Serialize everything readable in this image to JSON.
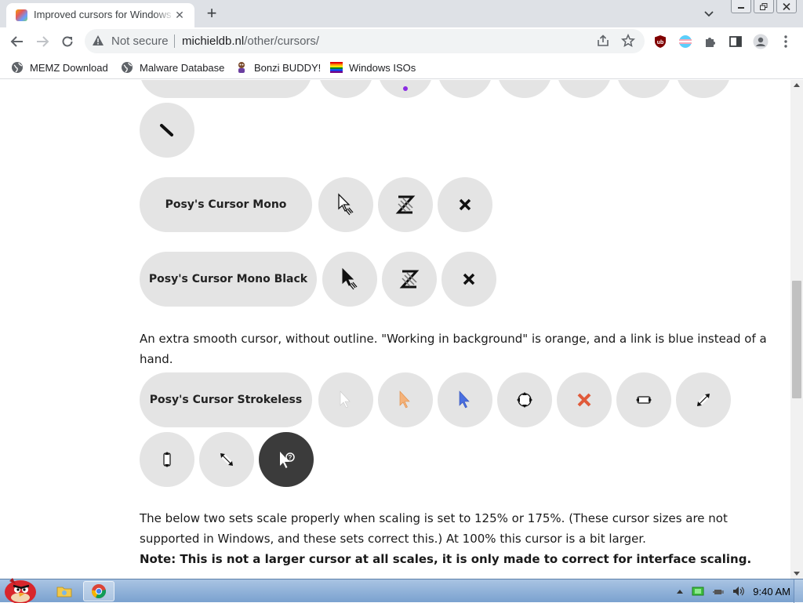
{
  "browser": {
    "tab_title": "Improved cursors for Windows",
    "omnibox": {
      "security_label": "Not secure",
      "domain": "michieldb.nl",
      "path": "/other/cursors/"
    },
    "bookmarks": [
      {
        "label": "MEMZ Download",
        "icon": "globe-icon"
      },
      {
        "label": "Malware Database",
        "icon": "globe-icon"
      },
      {
        "label": "Bonzi BUDDY!",
        "icon": "bonzi-icon"
      },
      {
        "label": "Windows ISOs",
        "icon": "rainbow-flag-icon"
      }
    ]
  },
  "page": {
    "sets": [
      {
        "name": "Posy's Cursor Mono"
      },
      {
        "name": "Posy's Cursor Mono Black"
      },
      {
        "name": "Posy's Cursor Strokeless"
      }
    ],
    "paragraph_strokeless": "An extra smooth cursor, without outline. \"Working in background\" is orange, and a link is blue instead of a hand.",
    "paragraph_scaling": "The below two sets scale properly when scaling is set to 125% or 175%. (These cursor sizes are not supported in Windows, and these sets correct this.) At 100% this cursor is a bit larger.",
    "note": "Note: This is not a larger cursor at all scales, it is only made to correct for interface scaling."
  },
  "taskbar": {
    "clock": "9:40 AM"
  },
  "colors": {
    "pill_bg": "#e4e4e4",
    "orange_cursor": "#f0a050",
    "blue_cursor": "#4a6fe0",
    "red_x": "#e05a3a"
  }
}
